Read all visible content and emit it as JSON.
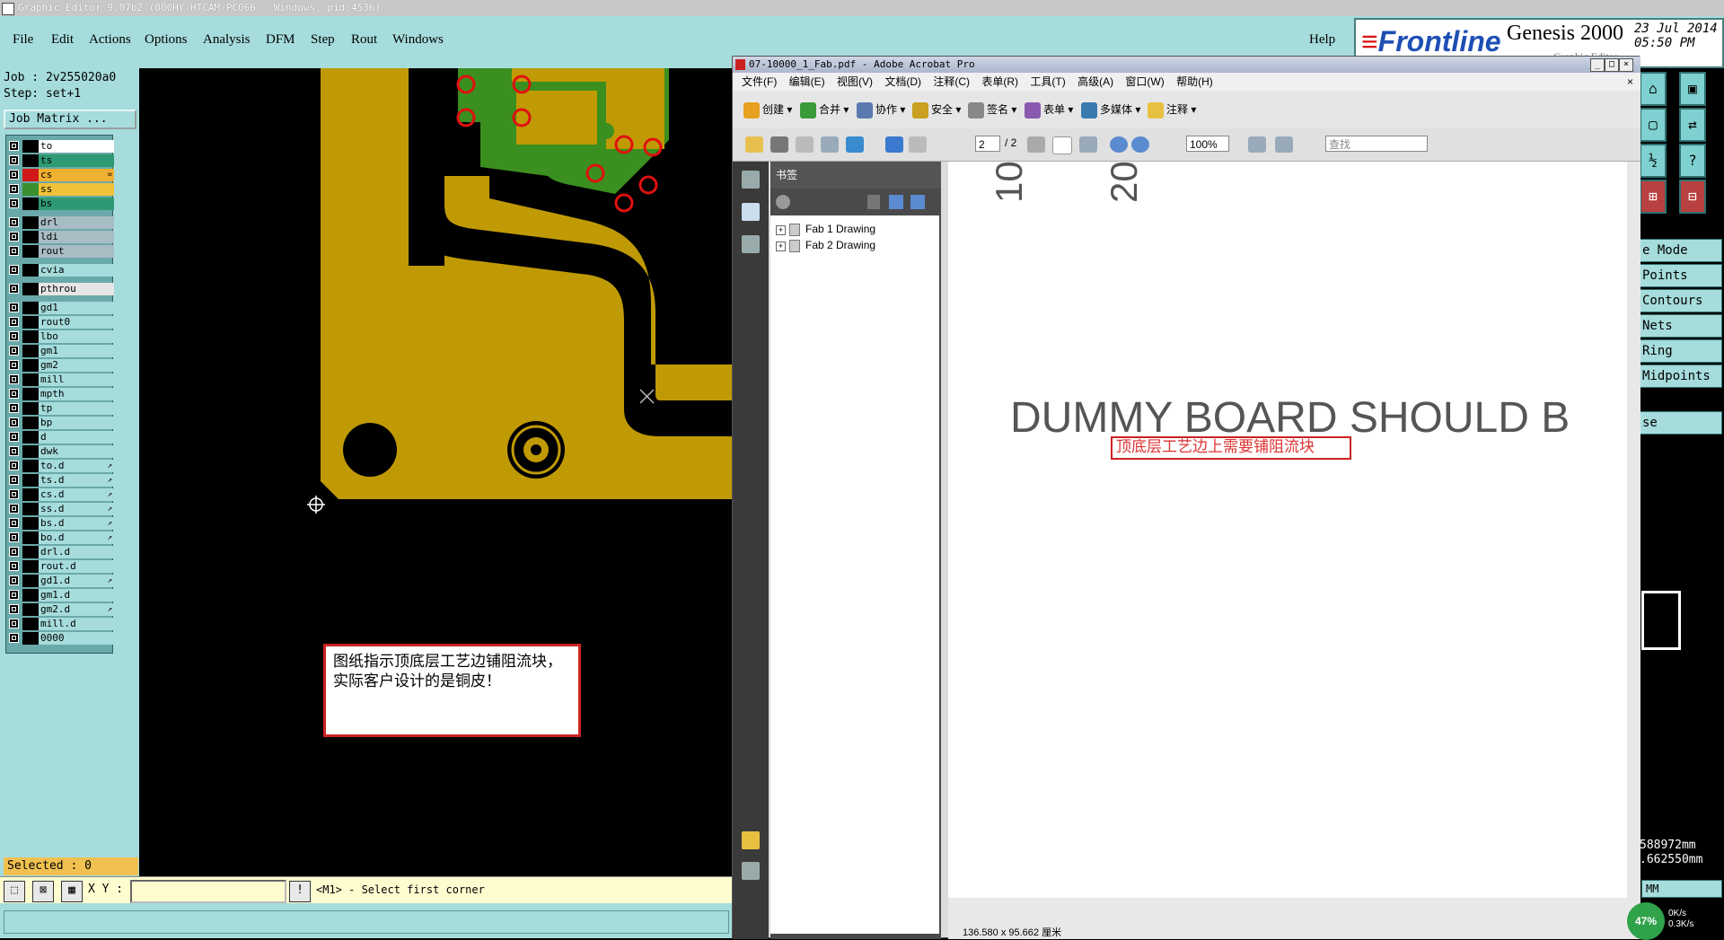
{
  "genesis": {
    "title": "Graphic Editor 9.07b2 (000HY-HTCAM-PC066 - Windows, pid:4536)",
    "menu": [
      "File",
      "Edit",
      "Actions",
      "Options",
      "Analysis",
      "DFM",
      "Step",
      "Rout",
      "Windows"
    ],
    "help": "Help",
    "brand": {
      "logo": "Frontline",
      "product": "Genesis 2000",
      "date": "23 Jul 2014",
      "time": "05:50 PM",
      "subtitle": "Graphic Editor"
    },
    "job": "Job : 2v255020a0",
    "step": "Step: set+1",
    "job_matrix": "Job Matrix ...",
    "layers": [
      {
        "name": "to",
        "color": "#ffffff",
        "sw": "#000000",
        "mark": ""
      },
      {
        "name": "ts",
        "color": "#2e9a73",
        "sw": "#000000",
        "mark": ""
      },
      {
        "name": "cs",
        "color": "#f0b030",
        "sw": "#d01818",
        "mark": "="
      },
      {
        "name": "ss",
        "color": "#f0c23a",
        "sw": "#3a8f2e",
        "mark": ""
      },
      {
        "name": "bs",
        "color": "#2e9a73",
        "sw": "#000000",
        "mark": ""
      },
      {
        "name": "drl",
        "color": "#a8bcc4",
        "sw": "#000000",
        "mark": ""
      },
      {
        "name": "ldi",
        "color": "#a8bcc4",
        "sw": "#000000",
        "mark": ""
      },
      {
        "name": "rout",
        "color": "#a8bcc4",
        "sw": "#000000",
        "mark": ""
      },
      {
        "name": "cvia",
        "color": "#a6dcdc",
        "sw": "#000000",
        "mark": ""
      },
      {
        "name": "pthrou",
        "color": "#e6e6e6",
        "sw": "#000000",
        "mark": ""
      },
      {
        "name": "gd1",
        "color": "#a6dcdc",
        "sw": "#000000",
        "mark": ""
      },
      {
        "name": "rout0",
        "color": "#a6dcdc",
        "sw": "#000000",
        "mark": ""
      },
      {
        "name": "lbo",
        "color": "#a6dcdc",
        "sw": "#000000",
        "mark": ""
      },
      {
        "name": "gm1",
        "color": "#a6dcdc",
        "sw": "#000000",
        "mark": ""
      },
      {
        "name": "gm2",
        "color": "#a6dcdc",
        "sw": "#000000",
        "mark": ""
      },
      {
        "name": "mill",
        "color": "#a6dcdc",
        "sw": "#000000",
        "mark": ""
      },
      {
        "name": "mpth",
        "color": "#a6dcdc",
        "sw": "#000000",
        "mark": ""
      },
      {
        "name": "tp",
        "color": "#a6dcdc",
        "sw": "#000000",
        "mark": ""
      },
      {
        "name": "bp",
        "color": "#a6dcdc",
        "sw": "#000000",
        "mark": ""
      },
      {
        "name": "d",
        "color": "#a6dcdc",
        "sw": "#000000",
        "mark": ""
      },
      {
        "name": "dwk",
        "color": "#a6dcdc",
        "sw": "#000000",
        "mark": ""
      },
      {
        "name": "to.d",
        "color": "#a6dcdc",
        "sw": "#000000",
        "mark": "↗"
      },
      {
        "name": "ts.d",
        "color": "#a6dcdc",
        "sw": "#000000",
        "mark": "↗"
      },
      {
        "name": "cs.d",
        "color": "#a6dcdc",
        "sw": "#000000",
        "mark": "↗"
      },
      {
        "name": "ss.d",
        "color": "#a6dcdc",
        "sw": "#000000",
        "mark": "↗"
      },
      {
        "name": "bs.d",
        "color": "#a6dcdc",
        "sw": "#000000",
        "mark": "↗"
      },
      {
        "name": "bo.d",
        "color": "#a6dcdc",
        "sw": "#000000",
        "mark": "↗"
      },
      {
        "name": "drl.d",
        "color": "#a6dcdc",
        "sw": "#000000",
        "mark": ""
      },
      {
        "name": "rout.d",
        "color": "#a6dcdc",
        "sw": "#000000",
        "mark": ""
      },
      {
        "name": "gd1.d",
        "color": "#a6dcdc",
        "sw": "#000000",
        "mark": "↗"
      },
      {
        "name": "gm1.d",
        "color": "#a6dcdc",
        "sw": "#000000",
        "mark": ""
      },
      {
        "name": "gm2.d",
        "color": "#a6dcdc",
        "sw": "#000000",
        "mark": "↗"
      },
      {
        "name": "mill.d",
        "color": "#a6dcdc",
        "sw": "#000000",
        "mark": ""
      },
      {
        "name": "0000",
        "color": "#a6dcdc",
        "sw": "#000000",
        "mark": ""
      }
    ],
    "selected": "Selected : 0",
    "xy_label": "X Y :",
    "status": "<M1> - Select first corner",
    "annotation": "图纸指示顶底层工艺边铺阻流块，实际客户设计的是铜皮！",
    "right_items": [
      "e Mode",
      "Points",
      "Contours",
      "Nets",
      "Ring",
      "Midpoints",
      "se"
    ],
    "coords": [
      "588972mm",
      ".662550mm"
    ],
    "units": "MM"
  },
  "acrobat": {
    "title": "07-10000_1_Fab.pdf - Adobe Acrobat Pro",
    "menu": [
      "文件(F)",
      "编辑(E)",
      "视图(V)",
      "文档(D)",
      "注释(C)",
      "表单(R)",
      "工具(T)",
      "高级(A)",
      "窗口(W)",
      "帮助(H)"
    ],
    "toolbar": [
      "创建",
      "合并",
      "协作",
      "安全",
      "签名",
      "表单",
      "多媒体",
      "注释"
    ],
    "page_current": "2",
    "page_total": "/ 2",
    "zoom": "100%",
    "find_placeholder": "查找",
    "bookmarks_title": "书签",
    "bookmarks": [
      "Fab 1 Drawing",
      "Fab 2 Drawing"
    ],
    "doc_heading": "DUMMY BOARD SHOULD B",
    "doc_note": "顶底层工艺边上需要铺阻流块",
    "rot_labels": [
      "10",
      "20"
    ],
    "page_size": "136.580 x 95.662 厘米"
  },
  "network": {
    "percent": "47%",
    "up": "0K/s",
    "down": "0.3K/s"
  }
}
